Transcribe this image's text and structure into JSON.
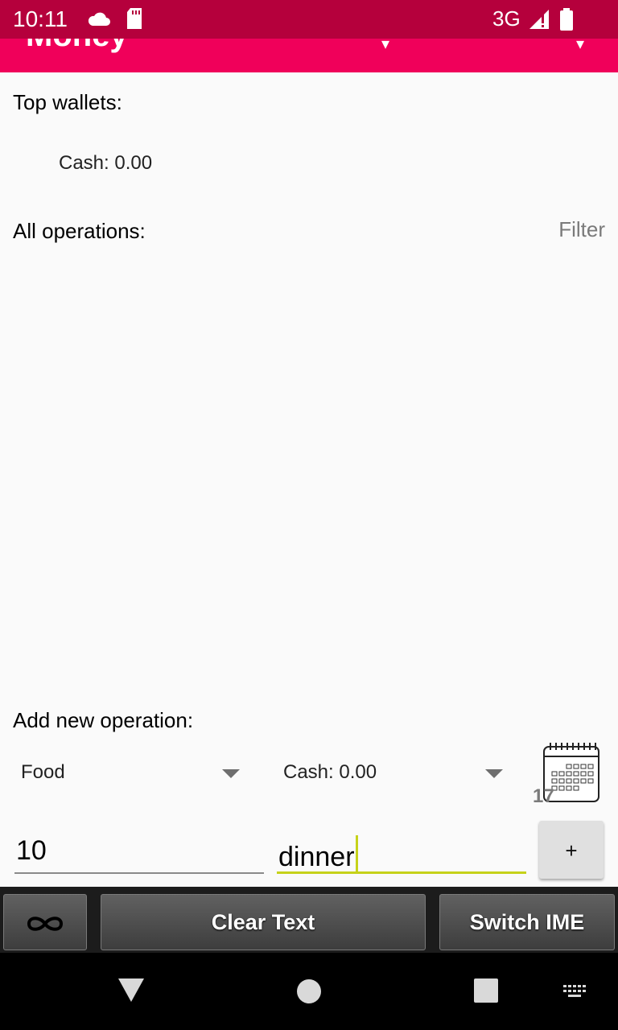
{
  "status_bar": {
    "time": "10:11",
    "network": "3G",
    "icons": [
      "cloud-icon",
      "sd-card-icon",
      "signal-icon",
      "battery-icon"
    ]
  },
  "app_bar": {
    "title": "Money",
    "icons": [
      "dropdown-icon",
      "overflow-icon"
    ]
  },
  "top_wallets": {
    "heading": "Top wallets:",
    "items": [
      "Cash: 0.00"
    ]
  },
  "operations": {
    "heading": "All operations:",
    "filter_label": "Filter"
  },
  "new_operation": {
    "heading": "Add new operation:",
    "category_selected": "Food",
    "wallet_selected": "Cash: 0.00",
    "calendar_day": "17",
    "amount_value": "10",
    "note_value": "dinner",
    "add_label": "+"
  },
  "keyboard_bar": {
    "clear_label": "Clear Text",
    "switch_label": "Switch IME",
    "icons": [
      "infinity-icon"
    ]
  },
  "nav_bar": {
    "icons": [
      "back-icon",
      "home-icon",
      "recents-icon",
      "keyboard-icon"
    ]
  },
  "colors": {
    "status_bar": "#b5003c",
    "app_bar": "#f0005a",
    "focus_accent": "#c6d21a"
  }
}
